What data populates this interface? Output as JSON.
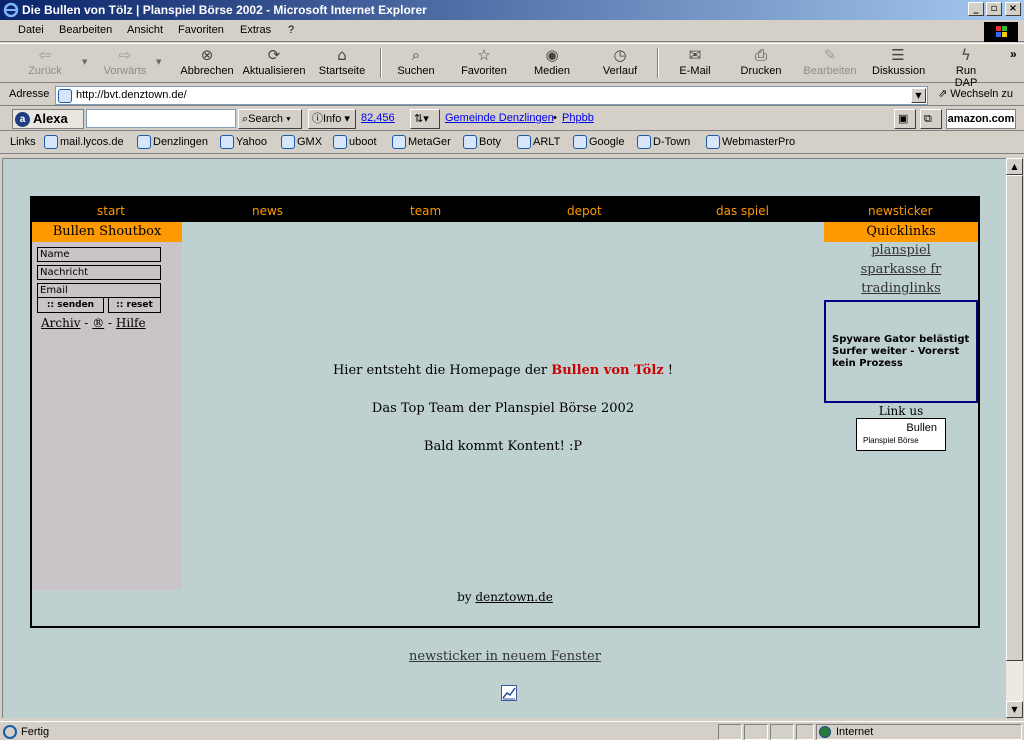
{
  "window": {
    "title": "Die Bullen von Tölz | Planspiel Börse 2002 - Microsoft Internet Explorer"
  },
  "menu": [
    "Datei",
    "Bearbeiten",
    "Ansicht",
    "Favoriten",
    "Extras",
    "?"
  ],
  "toolbar": {
    "back": "Zurück",
    "forward": "Vorwärts",
    "stop": "Abbrechen",
    "refresh": "Aktualisieren",
    "home": "Startseite",
    "search": "Suchen",
    "favorites": "Favoriten",
    "media": "Medien",
    "history": "Verlauf",
    "mail": "E-Mail",
    "print": "Drucken",
    "edit": "Bearbeiten",
    "discuss": "Diskussion",
    "rundap": "Run DAP",
    "more": "»"
  },
  "address": {
    "label": "Adresse",
    "url": "http://bvt.denztown.de/",
    "go": "Wechseln zu"
  },
  "alexa": {
    "logo": "Alexa",
    "search": "Search",
    "info": "Info",
    "rank": "82,456",
    "link1": "Gemeinde Denzlingen",
    "link2": "Phpbb",
    "amazon": "amazon.com"
  },
  "links": {
    "label": "Links",
    "items": [
      "mail.lycos.de",
      "Denzlingen",
      "Yahoo",
      "GMX",
      "uboot",
      "MetaGer",
      "Boty",
      "ARLT",
      "Google",
      "D-Town",
      "WebmasterPro"
    ]
  },
  "page": {
    "nav": [
      "start",
      "news",
      "team",
      "depot",
      "das spiel",
      "newsticker"
    ],
    "shoutbox": {
      "title": "Bullen Shoutbox",
      "name": "Name",
      "message": "Nachricht",
      "email": "Email",
      "send": ":: senden",
      "reset": ":: reset",
      "archiv": "Archiv",
      "sep": "-",
      "reg": "®",
      "hilfe": "Hilfe"
    },
    "main": {
      "line1_pre": "Hier entsteht die Homepage der",
      "line1_red": "Bullen von Tölz",
      "line1_post": "!",
      "line2": "Das Top Team der Planspiel Börse 2002",
      "line3": "Bald kommt Kontent! :P"
    },
    "quicklinks": {
      "title": "Quicklinks",
      "items": [
        "planspiel",
        "sparkasse fr",
        "tradinglinks"
      ],
      "news": "Spyware Gator belästigt Surfer weiter - Vorerst kein Prozess",
      "linkus": "Link us",
      "banner_big": "Bullen",
      "banner_small": "Planspiel Börse"
    },
    "by": "by",
    "by_link": "denztown.de",
    "newsticker_window": "newsticker in neuem Fenster"
  },
  "status": {
    "left": "Fertig",
    "zone": "Internet"
  }
}
